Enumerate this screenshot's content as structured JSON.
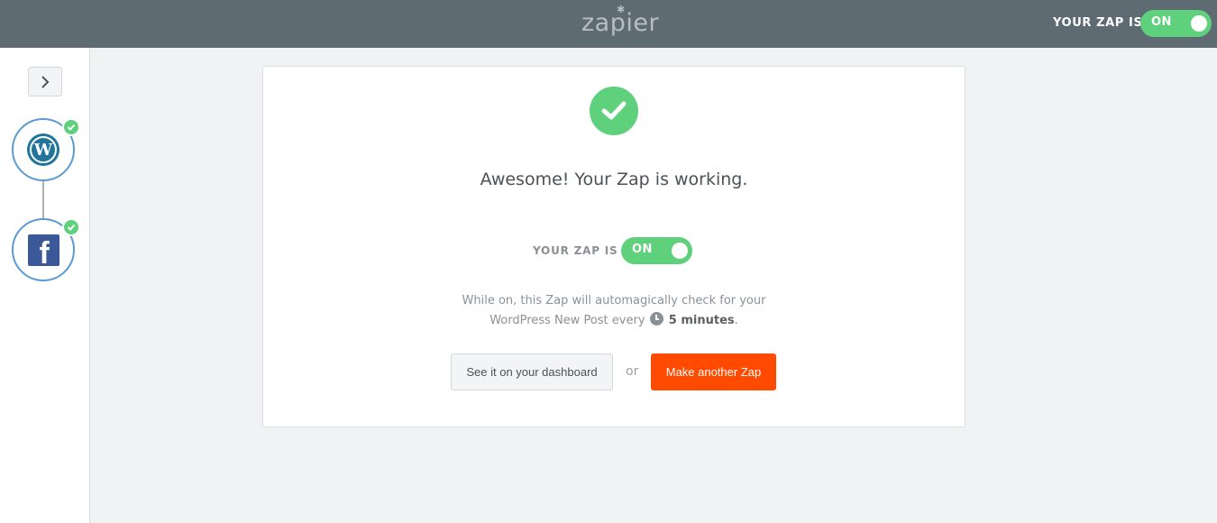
{
  "header": {
    "logo": "zapier",
    "zap_status_label": "YOUR ZAP IS",
    "zap_toggle": "ON"
  },
  "sidebar": {
    "expand_icon": "chevron-right-icon",
    "steps": [
      {
        "app": "WordPress",
        "icon": "wordpress-icon",
        "status_icon": "check-icon"
      },
      {
        "app": "Facebook",
        "icon": "facebook-icon",
        "status_icon": "check-icon"
      }
    ]
  },
  "main": {
    "success_icon": "check-icon",
    "headline": "Awesome! Your Zap is working.",
    "zap_status_label": "YOUR ZAP IS",
    "zap_toggle": "ON",
    "info_line1": "While on, this Zap will automagically check for your",
    "info_line2_prefix": "WordPress New Post every",
    "info_interval": "5 minutes",
    "info_suffix": ".",
    "dashboard_button": "See it on your dashboard",
    "or_text": "or",
    "make_zap_button": "Make another Zap"
  },
  "colors": {
    "header_bg": "#5f6b72",
    "toggle_on": "#5fd07b",
    "accent_orange": "#ff4a00",
    "step_border": "#5b9bd5",
    "wordpress_blue": "#21759b",
    "facebook_blue": "#3b5998"
  }
}
